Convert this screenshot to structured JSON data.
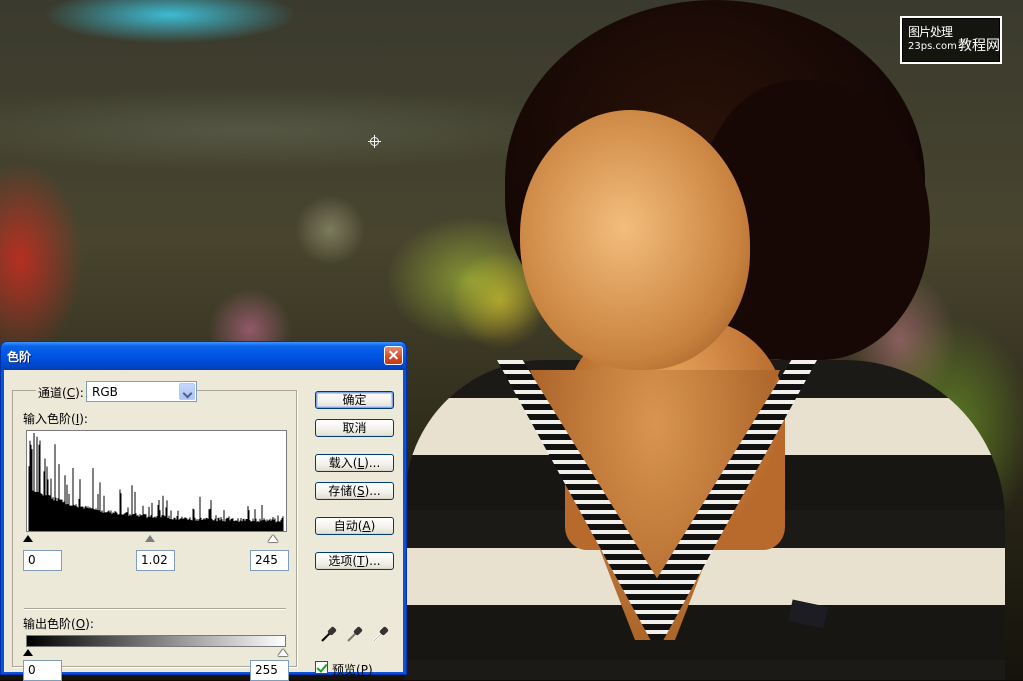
{
  "watermark": {
    "line1": "图片处理",
    "line2": "23ps.com",
    "line3": "教程网"
  },
  "dialog": {
    "title": "色阶",
    "channel": {
      "label": "通道",
      "mnemonic": "C",
      "selected": "RGB"
    },
    "input_levels": {
      "label": "输入色阶",
      "mnemonic": "I",
      "black": "0",
      "gamma": "1.02",
      "white": "245"
    },
    "output_levels": {
      "label": "输出色阶",
      "mnemonic": "O",
      "black": "0",
      "white": "255"
    },
    "buttons": {
      "ok": "确定",
      "cancel": "取消",
      "load": {
        "label": "载入",
        "mnemonic": "L",
        "suffix": "..."
      },
      "save": {
        "label": "存储",
        "mnemonic": "S",
        "suffix": "..."
      },
      "auto": {
        "label": "自动",
        "mnemonic": "A",
        "suffix": ""
      },
      "options": {
        "label": "选项",
        "mnemonic": "T",
        "suffix": "..."
      }
    },
    "preview": {
      "label": "预览",
      "mnemonic": "P",
      "checked": true
    },
    "eyedroppers": [
      "black-point-eyedropper-icon",
      "gray-point-eyedropper-icon",
      "white-point-eyedropper-icon"
    ]
  }
}
